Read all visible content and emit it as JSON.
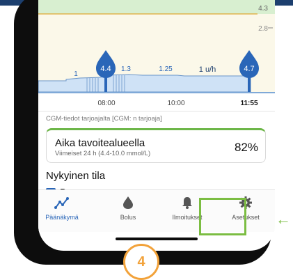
{
  "chart": {
    "y_labels": [
      "4.3",
      "2.8"
    ],
    "events": [
      {
        "label": "4.4",
        "time": "07:45"
      },
      {
        "label": "4.7",
        "time": "11:55"
      }
    ],
    "basal_labels": [
      "1",
      "1.3",
      "1.25",
      "1 u/h"
    ],
    "x_ticks": [
      "08:00",
      "10:00",
      "11:55"
    ],
    "colors": {
      "glucose_band": "#d8efd0",
      "upper_line": "#e0a830",
      "basal_fill": "#cfe2f6",
      "drop": "#2a66b8"
    }
  },
  "source_note": "CGM-tiedot tarjoajalta [CGM: n tarjoaja]",
  "card": {
    "title": "Aika tavoitealueella",
    "subtitle": "Viimeiset 24 h (4.4-10.0 mmol/L)",
    "value": "82%"
  },
  "status": {
    "title": "Nykyinen tila",
    "badge": "B",
    "row_text": "Peruseonnos"
  },
  "tabs": [
    {
      "label": "Päänäkymä",
      "icon": "trend-icon",
      "active": true
    },
    {
      "label": "Bolus",
      "icon": "drop-icon",
      "active": false
    },
    {
      "label": "Ilmoitukset",
      "icon": "bell-icon",
      "active": false
    },
    {
      "label": "Asetukset",
      "icon": "gear-icon",
      "active": false
    }
  ],
  "callout": {
    "step": "4",
    "arrow": "←",
    "accent": "#7bbd42",
    "step_color": "#f2a23a"
  }
}
